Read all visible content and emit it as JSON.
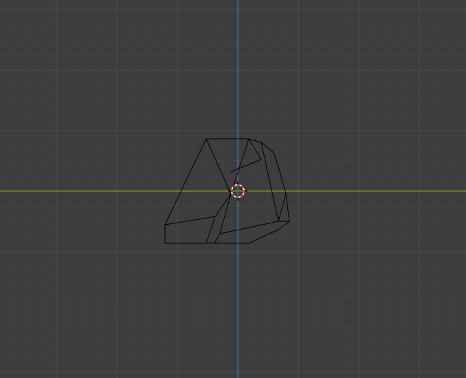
{
  "viewport": {
    "background_color": "#3d3d3d",
    "grid_minor_color": "#444444",
    "grid_major_color": "#4b4b4b",
    "x_axis_color": "#7fa32b",
    "y_axis_color": "#3f7bb5",
    "wireframe_color": "#000000"
  },
  "cursor_3d": {
    "icon": "3d-cursor-icon",
    "ring_color_a": "#ff3b30",
    "ring_color_b": "#ffffff"
  },
  "object": {
    "name": "",
    "display": "wireframe"
  }
}
